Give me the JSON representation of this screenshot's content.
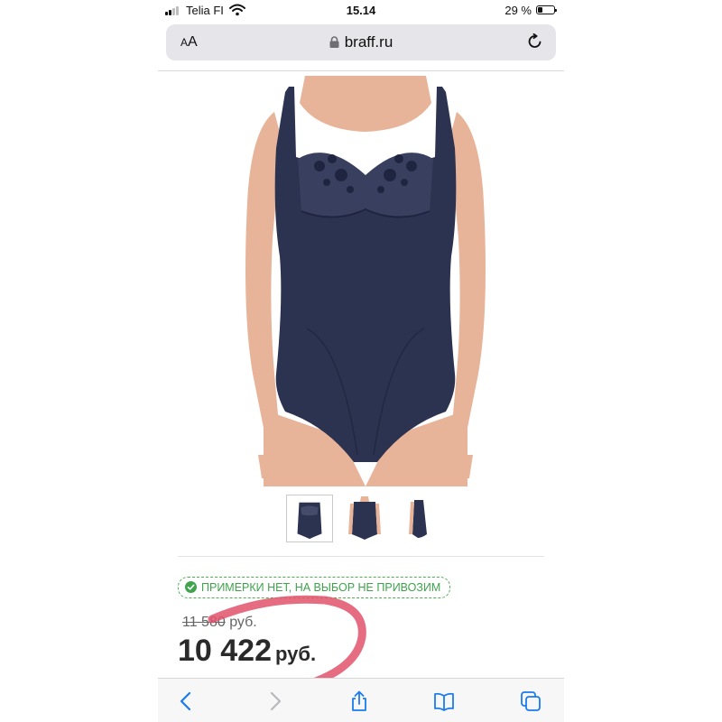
{
  "status_bar": {
    "carrier": "Telia FI",
    "time": "15.14",
    "battery_percent": "29 %",
    "battery_level": 0.29
  },
  "browser": {
    "reader_label_small": "A",
    "reader_label_large": "A",
    "url": "braff.ru"
  },
  "product": {
    "image_icon": "bodysuit-photo",
    "thumbnails": [
      "bodysuit-front-thumbnail",
      "bodysuit-model-thumbnail",
      "bodysuit-side-thumbnail"
    ],
    "notice": "ПРИМЕРКИ НЕТ, НА ВЫБОР НЕ ПРИВОЗИМ",
    "old_price": "11 580",
    "old_price_currency": "руб.",
    "price": "10 422",
    "price_currency": "руб."
  },
  "toolbar": [
    "back-icon",
    "forward-icon",
    "share-icon",
    "bookmarks-icon",
    "tabs-icon"
  ],
  "colors": {
    "accent": "#1a7bef",
    "notice_green": "#3fa34d",
    "garment": "#2c3350",
    "annotation": "#e2546b"
  }
}
